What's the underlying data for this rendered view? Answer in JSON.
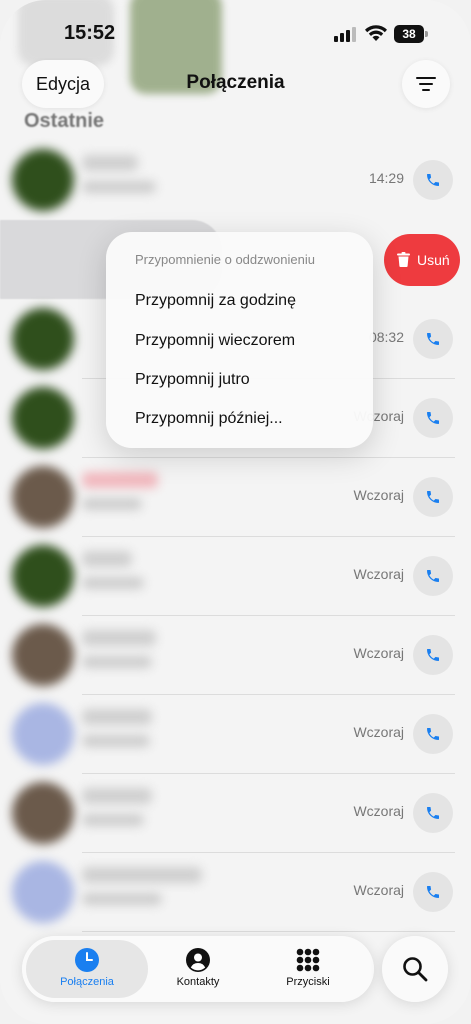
{
  "status_bar": {
    "time": "15:52",
    "battery": "38"
  },
  "header": {
    "edit_label": "Edycja",
    "title": "Połączenia",
    "section_title": "Ostatnie",
    "filter_icon": "filter-lines-icon"
  },
  "calls": [
    {
      "time": "14:29",
      "avatar": "#2f4f1c",
      "name_color": "#cfcfcf"
    },
    {
      "time": "08:32",
      "avatar": "#2f4f1c",
      "name_color": "#cfcfcf"
    },
    {
      "time": "Wczoraj",
      "avatar": "#2f4f1c",
      "name_color": "#cfcfcf"
    },
    {
      "time": "Wczoraj",
      "avatar": "#6b5a4b",
      "name_color": "#f1b7bd"
    },
    {
      "time": "Wczoraj",
      "avatar": "#2f4f1c",
      "name_color": "#cfcfcf"
    },
    {
      "time": "Wczoraj",
      "avatar": "#6b5a4b",
      "name_color": "#cfcfcf"
    },
    {
      "time": "Wczoraj",
      "avatar": "#a9b6e3",
      "name_color": "#cfcfcf"
    },
    {
      "time": "Wczoraj",
      "avatar": "#6b5a4b",
      "name_color": "#cfcfcf"
    },
    {
      "time": "Wczoraj",
      "avatar": "#a9b6e3",
      "name_color": "#cfcfcf"
    }
  ],
  "swipe_action": {
    "delete_label": "Usuń",
    "color": "#ee3b3f"
  },
  "menu": {
    "header": "Przypomnienie o oddzwonieniu",
    "items": [
      "Przypomnij za godzinę",
      "Przypomnij wieczorem",
      "Przypomnij jutro",
      "Przypomnij później..."
    ]
  },
  "tabs": [
    {
      "label": "Połączenia",
      "icon": "clock-icon",
      "active": true
    },
    {
      "label": "Kontakty",
      "icon": "person-circle-icon",
      "active": false
    },
    {
      "label": "Przyciski",
      "icon": "keypad-icon",
      "active": false
    }
  ],
  "colors": {
    "accent": "#1a7ff0",
    "destructive": "#ee3b3f"
  }
}
